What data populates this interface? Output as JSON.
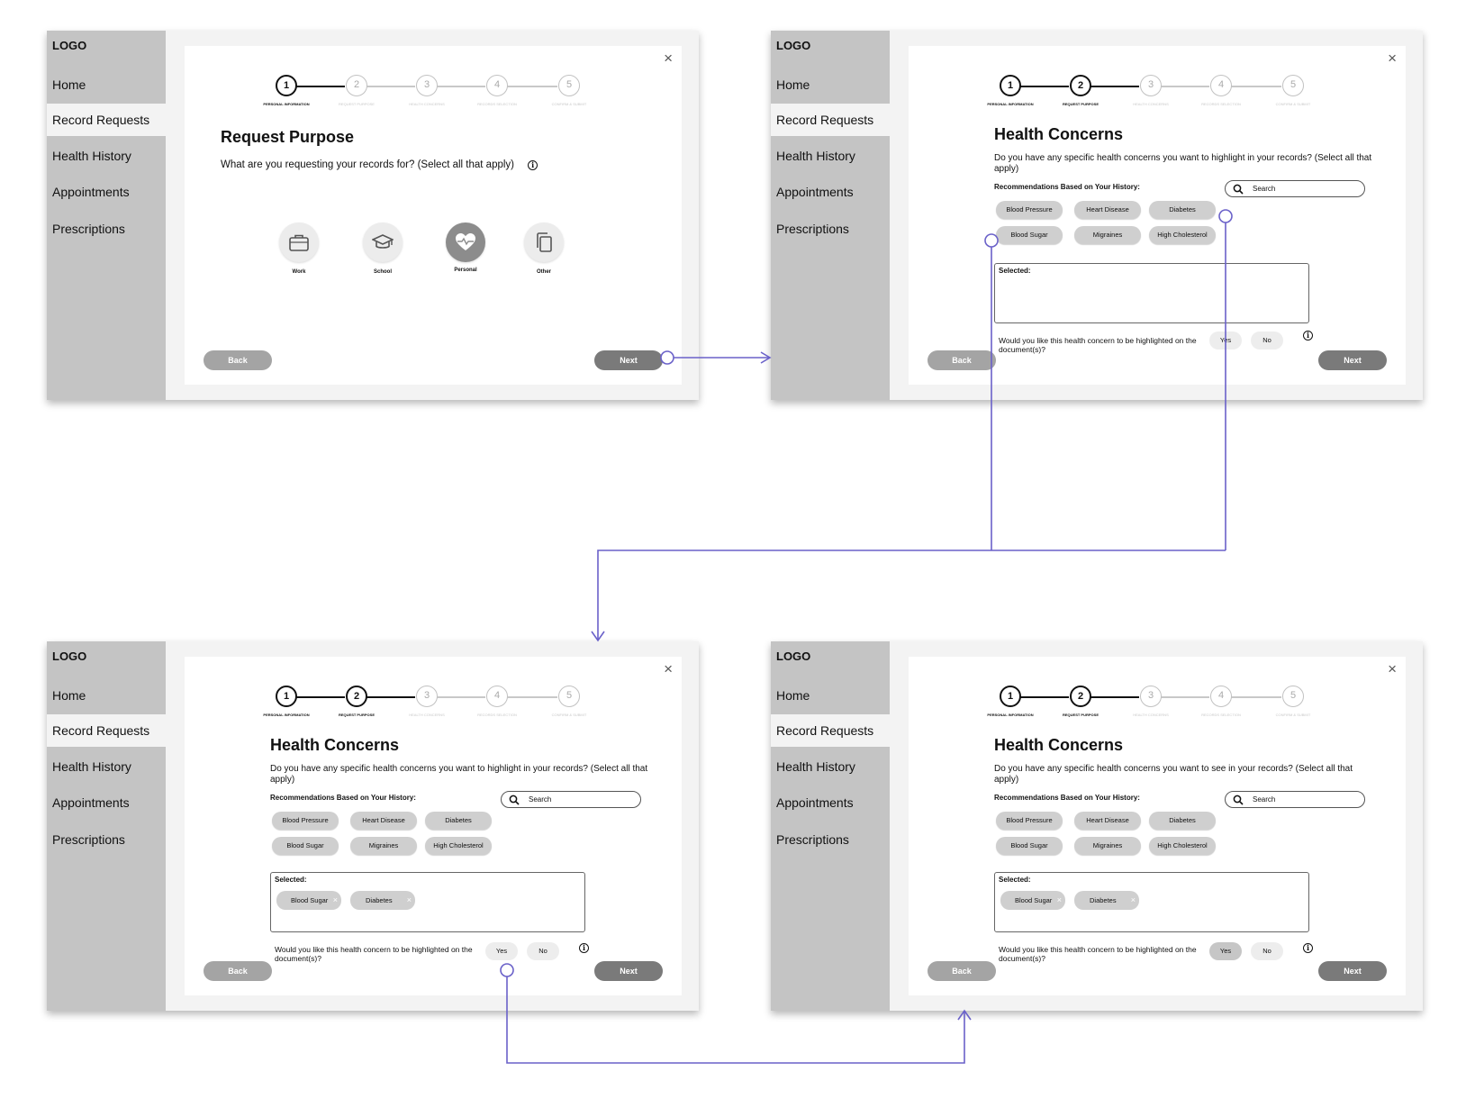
{
  "sidebar": {
    "logo": "LOGO",
    "items": [
      {
        "label": "Home"
      },
      {
        "label": "Record Requests"
      },
      {
        "label": "Health History"
      },
      {
        "label": "Appointments"
      },
      {
        "label": "Prescriptions"
      }
    ]
  },
  "stepper": [
    {
      "num": "1",
      "label": "PERSONAL INFORMATION"
    },
    {
      "num": "2",
      "label": "REQUEST PURPOSE"
    },
    {
      "num": "3",
      "label": "HEALTH CONCERNS"
    },
    {
      "num": "4",
      "label": "RECORDS SELECTION"
    },
    {
      "num": "5",
      "label": "CONFIRM & SUBMIT"
    }
  ],
  "close_glyph": "×",
  "screen1": {
    "title": "Request Purpose",
    "question": "What are you requesting your records for? (Select all that apply)",
    "options": [
      {
        "label": "Work",
        "icon": "briefcase-icon"
      },
      {
        "label": "School",
        "icon": "graduation-cap-icon"
      },
      {
        "label": "Personal",
        "icon": "heart-pulse-icon",
        "selected": true
      },
      {
        "label": "Other",
        "icon": "copy-icon"
      }
    ]
  },
  "health": {
    "title": "Health Concerns",
    "question_highlight": "Do you have any specific health concerns you want to highlight in your records? (Select all that apply)",
    "question_see": "Do you have any specific health concerns you want to see in your records? (Select all that apply)",
    "recommendations_label": "Recommendations Based on Your History:",
    "search_placeholder": "Search",
    "chips": [
      "Blood Pressure",
      "Heart Disease",
      "Diabetes",
      "Blood Sugar",
      "Migraines",
      "High Cholesterol"
    ],
    "selected_label": "Selected:",
    "selected_items": [
      "Blood Sugar",
      "Diabetes"
    ],
    "remove_glyph": "×",
    "highlight_question": "Would you like this health concern to be highlighted on the document(s)?",
    "yes_label": "Yes",
    "no_label": "No"
  },
  "buttons": {
    "back": "Back",
    "next": "Next"
  },
  "colors": {
    "connector": "#6a61c9",
    "sidebar": "#c4c4c4",
    "selected_option": "#8c8c8c"
  }
}
